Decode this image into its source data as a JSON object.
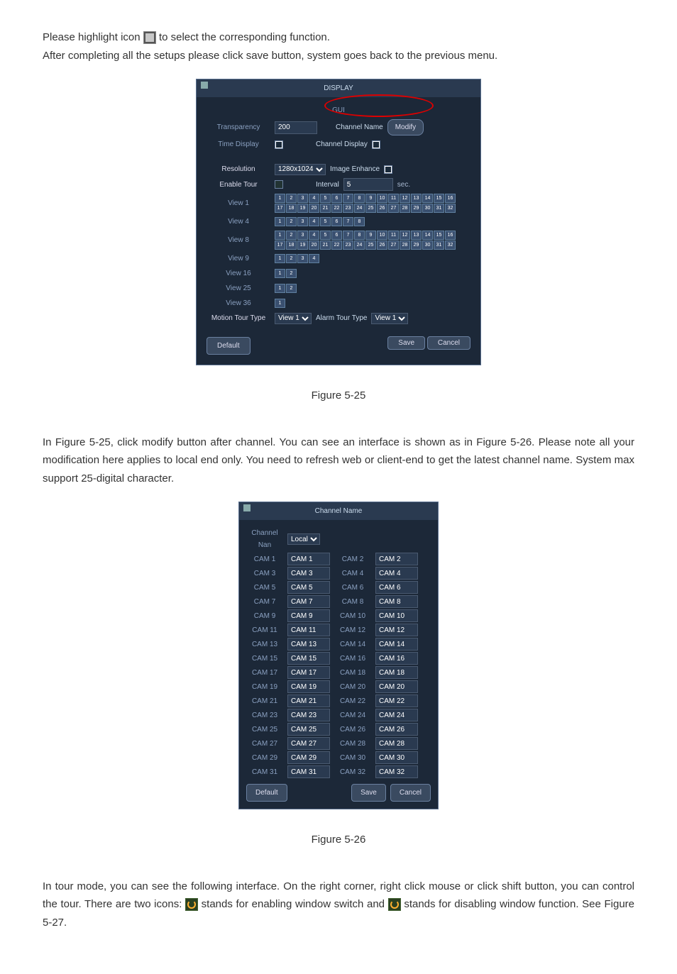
{
  "intro": {
    "line1a": "Please highlight icon ",
    "line1b": " to select the corresponding function.",
    "line2": "After completing all the setups please click save button, system goes back to the previous menu."
  },
  "display": {
    "title": "DISPLAY",
    "gui": "GUI",
    "transparency_lbl": "Transparency",
    "transparency_val": "200",
    "channel_name_lbl": "Channel Name",
    "modify_btn": "Modify",
    "time_display_lbl": "Time Display",
    "channel_display_lbl": "Channel Display",
    "resolution_lbl": "Resolution",
    "resolution_val": "1280x1024",
    "image_enhance_lbl": "Image Enhance",
    "enable_tour_lbl": "Enable Tour",
    "interval_lbl": "Interval",
    "interval_val": "5",
    "sec": "sec.",
    "view1": "View 1",
    "view4": "View 4",
    "view8": "View 8",
    "view9": "View 9",
    "view16": "View 16",
    "view25": "View 25",
    "view36": "View 36",
    "motion_tour_lbl": "Motion Tour Type",
    "motion_tour_val": "View 1",
    "alarm_tour_lbl": "Alarm Tour Type",
    "alarm_tour_val": "View 1",
    "default_btn": "Default",
    "save_btn": "Save",
    "cancel_btn": "Cancel"
  },
  "caption1": "Figure 5-25",
  "middle_para": "In Figure 5-25, click modify button after channel. You can see an interface is shown as in Figure 5-26. Please note all your modification here applies to local end only. You need to refresh web or client-end to get the latest channel name. System max support 25-digital character.",
  "channame": {
    "title": "Channel Name",
    "channel_nan_lbl": "Channel Nan",
    "local": "Local",
    "rows": [
      {
        "l1": "CAM 1",
        "v1": "CAM 1",
        "l2": "CAM 2",
        "v2": "CAM 2"
      },
      {
        "l1": "CAM 3",
        "v1": "CAM 3",
        "l2": "CAM 4",
        "v2": "CAM 4"
      },
      {
        "l1": "CAM 5",
        "v1": "CAM 5",
        "l2": "CAM 6",
        "v2": "CAM 6"
      },
      {
        "l1": "CAM 7",
        "v1": "CAM 7",
        "l2": "CAM 8",
        "v2": "CAM 8"
      },
      {
        "l1": "CAM 9",
        "v1": "CAM 9",
        "l2": "CAM 10",
        "v2": "CAM 10"
      },
      {
        "l1": "CAM 11",
        "v1": "CAM 11",
        "l2": "CAM 12",
        "v2": "CAM 12"
      },
      {
        "l1": "CAM 13",
        "v1": "CAM 13",
        "l2": "CAM 14",
        "v2": "CAM 14"
      },
      {
        "l1": "CAM 15",
        "v1": "CAM 15",
        "l2": "CAM 16",
        "v2": "CAM 16"
      },
      {
        "l1": "CAM 17",
        "v1": "CAM 17",
        "l2": "CAM 18",
        "v2": "CAM 18"
      },
      {
        "l1": "CAM 19",
        "v1": "CAM 19",
        "l2": "CAM 20",
        "v2": "CAM 20"
      },
      {
        "l1": "CAM 21",
        "v1": "CAM 21",
        "l2": "CAM 22",
        "v2": "CAM 22"
      },
      {
        "l1": "CAM 23",
        "v1": "CAM 23",
        "l2": "CAM 24",
        "v2": "CAM 24"
      },
      {
        "l1": "CAM 25",
        "v1": "CAM 25",
        "l2": "CAM 26",
        "v2": "CAM 26"
      },
      {
        "l1": "CAM 27",
        "v1": "CAM 27",
        "l2": "CAM 28",
        "v2": "CAM 28"
      },
      {
        "l1": "CAM 29",
        "v1": "CAM 29",
        "l2": "CAM 30",
        "v2": "CAM 30"
      },
      {
        "l1": "CAM 31",
        "v1": "CAM 31",
        "l2": "CAM 32",
        "v2": "CAM 32"
      }
    ],
    "default_btn": "Default",
    "save_btn": "Save",
    "cancel_btn": "Cancel"
  },
  "caption2": "Figure 5-26",
  "tour": {
    "p1": "In tour mode, you can see the following interface. On the right corner, right click mouse or click shift button, you can control the tour. There are two icons: ",
    "p2": " stands for enabling window switch and ",
    "p3": " stands for disabling window function. See Figure 5-27."
  }
}
